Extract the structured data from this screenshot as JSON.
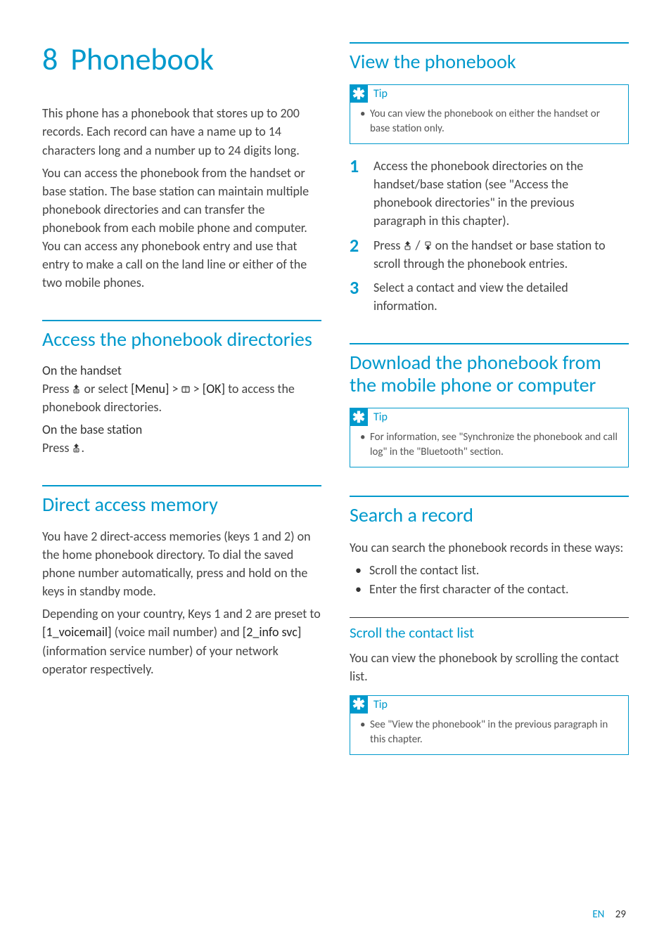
{
  "chapter": {
    "number": "8",
    "title": "Phonebook"
  },
  "left": {
    "intro1": "This phone has a phonebook that stores up to 200 records. Each record can have a name up to 14 characters long and a number up to 24 digits long.",
    "intro2": "You can access the phonebook from the handset or base station. The base station can maintain multiple phonebook directories and can transfer the phonebook from each mobile phone and computer. You can access any phonebook entry and use that entry to make a call on the land line or either of the two mobile phones.",
    "access": {
      "title": "Access the phonebook directories",
      "handset_label": "On the handset",
      "handset_text_pre": "Press ",
      "handset_text_mid": " or select ",
      "handset_menu": "[Menu]",
      "handset_gt1": " > ",
      "handset_ok": "[OK]",
      "handset_text_post": " to access the phonebook directories.",
      "base_label": "On the base station",
      "base_text_pre": "Press ",
      "base_text_post": "."
    },
    "direct": {
      "title": "Direct access memory",
      "p1": "You have 2 direct-access memories (keys 1 and 2) on the home phonebook directory. To dial the saved phone number automatically, press and hold on the keys in standby mode.",
      "p2_pre": "Depending on your country, Keys 1 and 2 are preset to ",
      "p2_vm": "[1_voicemail]",
      "p2_vm_desc": " (voice mail number) and ",
      "p2_info": "[2_info svc]",
      "p2_post": " (information service number) of your network operator respectively."
    }
  },
  "right": {
    "view": {
      "title": "View the phonebook",
      "tip_label": "Tip",
      "tip_text": "You can view the phonebook on either the handset or base station only.",
      "step1": "Access the phonebook directories on the handset/base station (see \"Access the phonebook directories\" in the previous paragraph in this chapter).",
      "step2_pre": "Press ",
      "step2_sep": " / ",
      "step2_post": " on the handset or base station to scroll through the phonebook entries.",
      "step3": "Select a contact and view the detailed information."
    },
    "download": {
      "title": "Download the phonebook from the mobile phone or computer",
      "tip_label": "Tip",
      "tip_text": "For information, see \"Synchronize the phonebook and call log\" in the \"Bluetooth\" section."
    },
    "search": {
      "title": "Search a record",
      "intro": "You can search the phonebook records in these ways:",
      "b1": "Scroll the contact list.",
      "b2": "Enter the first character of the contact.",
      "scroll_title": "Scroll the contact list",
      "scroll_text": "You can view the phonebook by scrolling the contact list.",
      "tip_label": "Tip",
      "tip_text": "See \"View the phonebook\" in the previous paragraph in this chapter."
    }
  },
  "footer": {
    "lang": "EN",
    "page": "29"
  }
}
